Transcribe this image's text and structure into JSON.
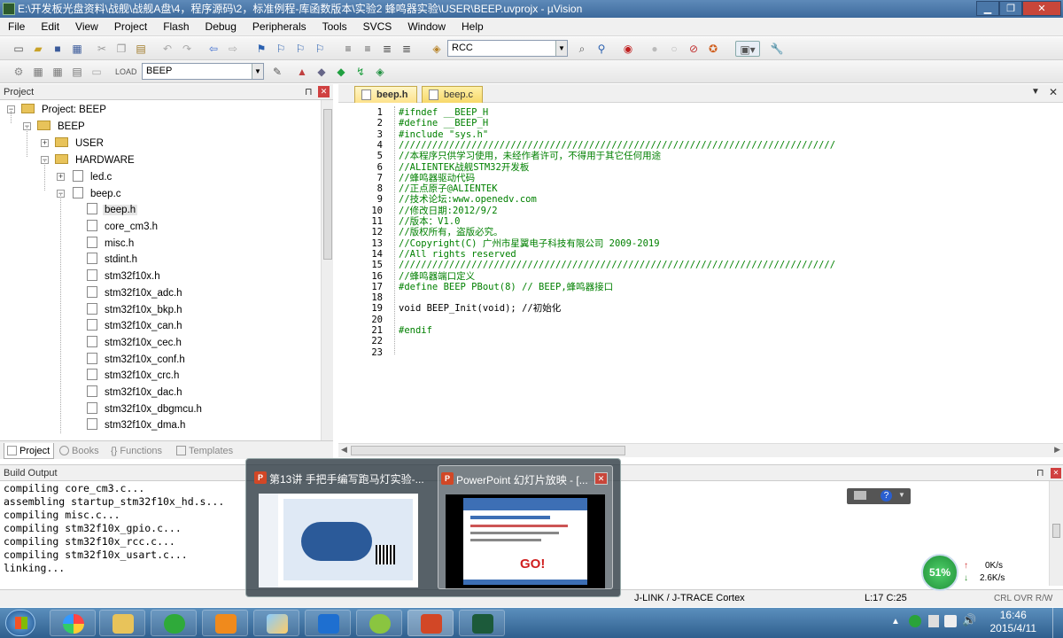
{
  "window": {
    "title": "E:\\开发板光盘资料\\战舰\\战舰A盘\\4，程序源码\\2，标准例程-库函数版本\\实验2 蜂鸣器实验\\USER\\BEEP.uvprojx - µVision",
    "minimize": "▁",
    "maximize": "❐",
    "close": "✕"
  },
  "menu": [
    "File",
    "Edit",
    "View",
    "Project",
    "Flash",
    "Debug",
    "Peripherals",
    "Tools",
    "SVCS",
    "Window",
    "Help"
  ],
  "toolbar1": {
    "find_combo": "RCC"
  },
  "toolbar2": {
    "target_combo": "BEEP"
  },
  "project": {
    "header": "Project",
    "tree": [
      {
        "label": "Project: BEEP",
        "depth": 0,
        "kind": "root",
        "exp": "⊟"
      },
      {
        "label": "BEEP",
        "depth": 1,
        "kind": "target",
        "exp": "⊟"
      },
      {
        "label": "USER",
        "depth": 2,
        "kind": "folder",
        "exp": "⊞"
      },
      {
        "label": "HARDWARE",
        "depth": 2,
        "kind": "folder",
        "exp": "⊟"
      },
      {
        "label": "led.c",
        "depth": 3,
        "kind": "file",
        "exp": "⊞"
      },
      {
        "label": "beep.c",
        "depth": 3,
        "kind": "file",
        "exp": "⊟"
      },
      {
        "label": "beep.h",
        "depth": 4,
        "kind": "file",
        "selected": true
      },
      {
        "label": "core_cm3.h",
        "depth": 4,
        "kind": "file"
      },
      {
        "label": "misc.h",
        "depth": 4,
        "kind": "file"
      },
      {
        "label": "stdint.h",
        "depth": 4,
        "kind": "file"
      },
      {
        "label": "stm32f10x.h",
        "depth": 4,
        "kind": "file"
      },
      {
        "label": "stm32f10x_adc.h",
        "depth": 4,
        "kind": "file"
      },
      {
        "label": "stm32f10x_bkp.h",
        "depth": 4,
        "kind": "file"
      },
      {
        "label": "stm32f10x_can.h",
        "depth": 4,
        "kind": "file"
      },
      {
        "label": "stm32f10x_cec.h",
        "depth": 4,
        "kind": "file"
      },
      {
        "label": "stm32f10x_conf.h",
        "depth": 4,
        "kind": "file"
      },
      {
        "label": "stm32f10x_crc.h",
        "depth": 4,
        "kind": "file"
      },
      {
        "label": "stm32f10x_dac.h",
        "depth": 4,
        "kind": "file"
      },
      {
        "label": "stm32f10x_dbgmcu.h",
        "depth": 4,
        "kind": "file"
      },
      {
        "label": "stm32f10x_dma.h",
        "depth": 4,
        "kind": "file"
      }
    ],
    "tabs": [
      "Project",
      "Books",
      "Functions",
      "Templates"
    ]
  },
  "editor": {
    "tabs": [
      "beep.h",
      "beep.c"
    ],
    "lines": [
      "#ifndef __BEEP_H",
      "#define __BEEP_H",
      "#include \"sys.h\"",
      "//////////////////////////////////////////////////////////////////////////////",
      "//本程序只供学习使用，未经作者许可，不得用于其它任何用途",
      "//ALIENTEK战舰STM32开发板",
      "//蜂鸣器驱动代码",
      "//正点原子@ALIENTEK",
      "//技术论坛:www.openedv.com",
      "//修改日期:2012/9/2",
      "//版本：V1.0",
      "//版权所有，盗版必究。",
      "//Copyright(C) 广州市星翼电子科技有限公司 2009-2019",
      "//All rights reserved",
      "//////////////////////////////////////////////////////////////////////////////",
      "//蜂鸣器端口定义",
      "#define BEEP PBout(8) // BEEP,蜂鸣器接口",
      "",
      "void BEEP_Init(void); //初始化",
      "",
      "#endif",
      "",
      ""
    ]
  },
  "build_output": {
    "header": "Build Output",
    "lines": [
      "compiling core_cm3.c...",
      "assembling startup_stm32f10x_hd.s...",
      "compiling misc.c...",
      "compiling stm32f10x_gpio.c...",
      "compiling stm32f10x_rcc.c...",
      "compiling stm32f10x_usart.c...",
      "linking..."
    ]
  },
  "status": {
    "debugger": "J-LINK / J-TRACE Cortex",
    "position": "L:17 C:25",
    "flags": "CRL  OVR  R/W"
  },
  "taskbar_popup": {
    "items": [
      {
        "title": "第13讲 手把手编写跑马灯实验-...",
        "icon": "P"
      },
      {
        "title": "PowerPoint 幻灯片放映 - [...",
        "icon": "P",
        "close": "✕",
        "preview_text": "GO!"
      }
    ]
  },
  "net": {
    "percent": "51%",
    "up": "0K/s",
    "down": "2.6K/s"
  },
  "clock": {
    "time": "16:46",
    "date": "2015/4/11"
  }
}
